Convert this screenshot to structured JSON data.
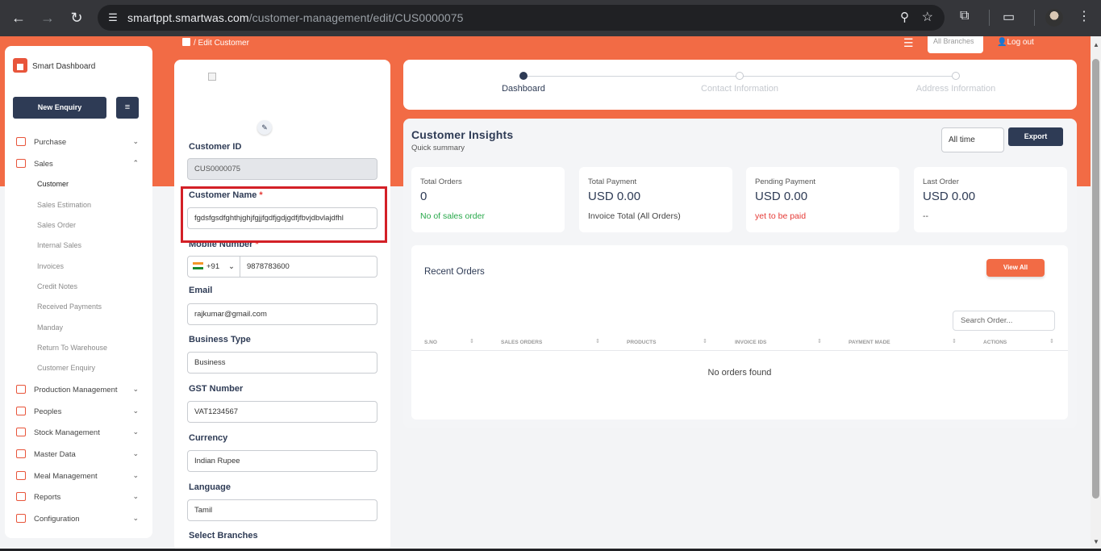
{
  "browser": {
    "url_host": "smartppt.smartwas.com",
    "url_path": "/customer-management/edit/CUS0000075"
  },
  "topbar": {
    "breadcrumb": "/  Edit Customer",
    "branch_select": "All Branches",
    "logout": "Log out"
  },
  "sidebar": {
    "brand": "Smart Dashboard",
    "new_enquiry": "New Enquiry",
    "items": [
      {
        "label": "Purchase",
        "chev": "⌄"
      },
      {
        "label": "Sales",
        "chev": "⌃"
      },
      {
        "label": "Production Management",
        "chev": "⌄"
      },
      {
        "label": "Peoples",
        "chev": "⌄"
      },
      {
        "label": "Stock Management",
        "chev": "⌄"
      },
      {
        "label": "Master Data",
        "chev": "⌄"
      },
      {
        "label": "Meal Management",
        "chev": "⌄"
      },
      {
        "label": "Reports",
        "chev": "⌄"
      },
      {
        "label": "Configuration",
        "chev": "⌄"
      }
    ],
    "sales_sub": [
      "Customer",
      "Sales Estimation",
      "Sales Order",
      "Internal Sales",
      "Invoices",
      "Credit Notes",
      "Received Payments",
      "Manday",
      "Return To Warehouse",
      "Customer Enquiry"
    ]
  },
  "form": {
    "customer_id_label": "Customer ID",
    "customer_id_value": "CUS0000075",
    "customer_name_label": "Customer Name",
    "customer_name_value": "fgdsfgsdfghthjghjfgjjfgdfjgdjgdfjfbvjdbvlajdfhl",
    "required_mark": "*",
    "mobile_label": "Mobile Number",
    "phone_code": "+91",
    "phone_number": "9878783600",
    "email_label": "Email",
    "email_value": "rajkumar@gmail.com",
    "business_type_label": "Business Type",
    "business_type_value": "Business",
    "gst_label": "GST Number",
    "gst_value": "VAT1234567",
    "currency_label": "Currency",
    "currency_value": "Indian Rupee",
    "language_label": "Language",
    "language_value": "Tamil",
    "branches_label": "Select Branches"
  },
  "stepper": {
    "steps": [
      "Dashboard",
      "Contact Information",
      "Address Information"
    ]
  },
  "insights": {
    "title": "Customer Insights",
    "subtitle": "Quick summary",
    "time_filter": "All time",
    "export": "Export",
    "stats": [
      {
        "label": "Total Orders",
        "value": "0",
        "note": "No of sales order"
      },
      {
        "label": "Total Payment",
        "value": "USD 0.00",
        "note": "Invoice Total (All Orders)"
      },
      {
        "label": "Pending Payment",
        "value": "USD 0.00",
        "note": "yet to be paid"
      },
      {
        "label": "Last Order",
        "value": "USD 0.00",
        "note": "--"
      }
    ],
    "recent_orders_title": "Recent Orders",
    "view_all": "View All",
    "search_placeholder": "Search Order...",
    "columns": [
      "S.NO",
      "SALES ORDERS",
      "PRODUCTS",
      "INVOICE IDS",
      "PAYMENT MADE",
      "ACTIONS"
    ],
    "empty_text": "No orders found"
  },
  "colors": {
    "brand_orange": "#f26b45",
    "navy": "#2e3b55",
    "highlight_red": "#d32027"
  }
}
